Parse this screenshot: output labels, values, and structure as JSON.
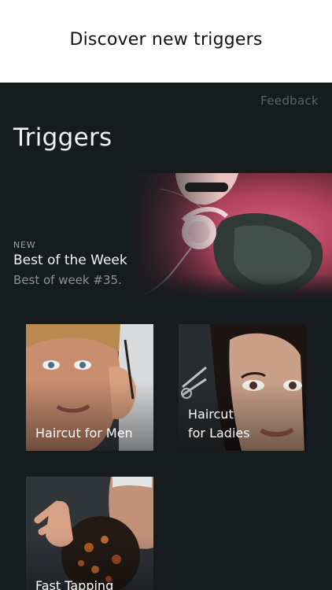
{
  "banner": {
    "text": "Discover new triggers"
  },
  "header": {
    "feedback_label": "Feedback",
    "title": "Triggers"
  },
  "featured": {
    "tag": "NEW",
    "title": "Best of the Week",
    "subtitle": "Best of week #35."
  },
  "grid": [
    {
      "label": "Haircut for Men"
    },
    {
      "label": "Haircut\nfor Ladies"
    },
    {
      "label": "Fast Tapping"
    }
  ]
}
